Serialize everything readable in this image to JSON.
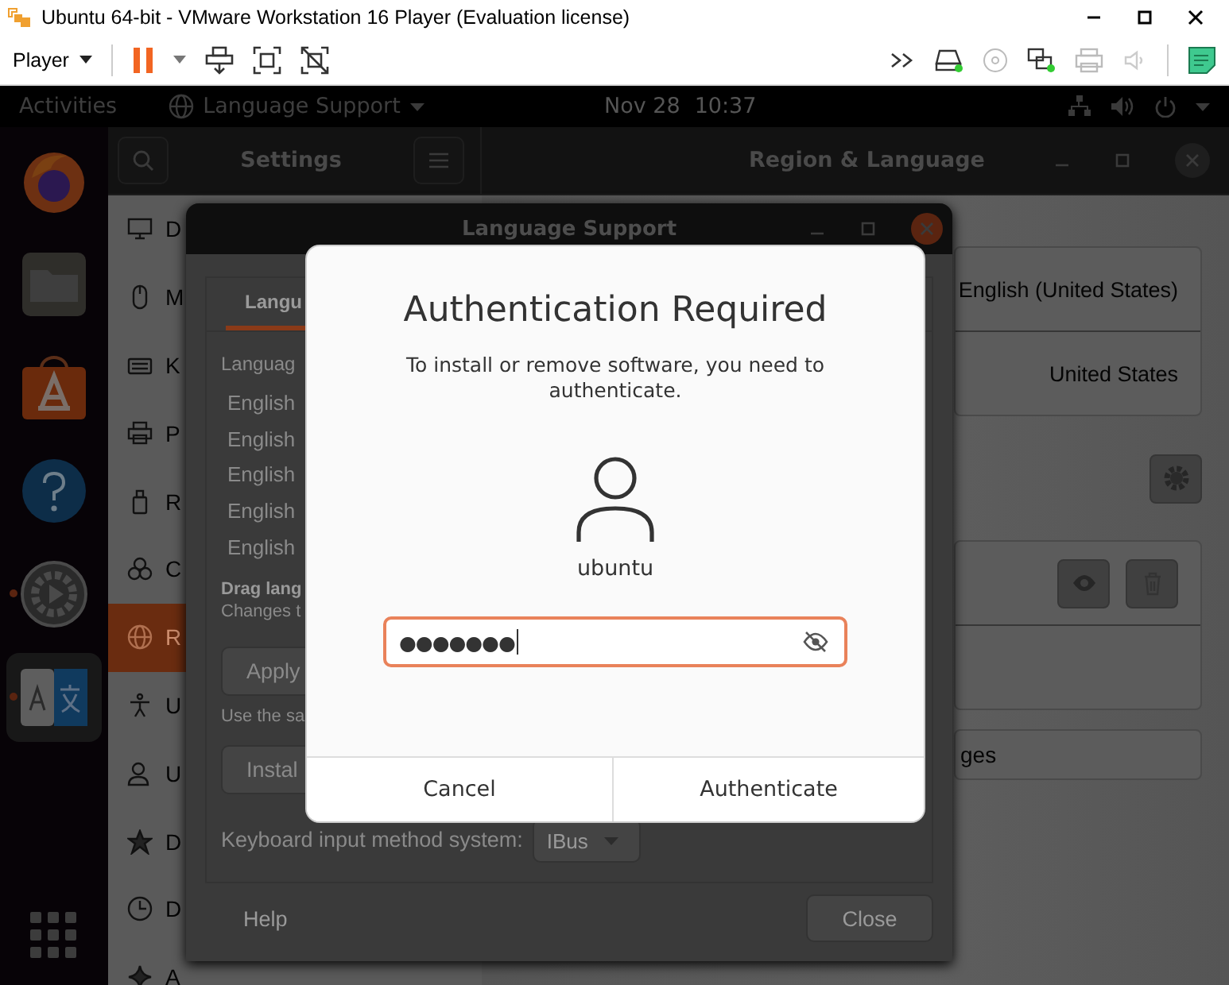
{
  "window": {
    "title": "Ubuntu 64-bit - VMware Workstation 16 Player (Evaluation license)"
  },
  "toolbar": {
    "player_menu": "Player"
  },
  "top_bar": {
    "activities": "Activities",
    "app_menu": "Language Support",
    "date": "Nov 28",
    "time": "10:37"
  },
  "dock": [
    {
      "kind": "firefox",
      "running": false,
      "selected": false
    },
    {
      "kind": "files",
      "running": false,
      "selected": false
    },
    {
      "kind": "software",
      "running": false,
      "selected": false
    },
    {
      "kind": "help",
      "running": false,
      "selected": false
    },
    {
      "kind": "media",
      "running": true,
      "selected": false
    },
    {
      "kind": "language",
      "running": true,
      "selected": true
    }
  ],
  "settings_window": {
    "title": "Settings",
    "panel_title": "Region & Language",
    "sidebar": [
      {
        "kind": "display",
        "label": "D",
        "selected": false
      },
      {
        "kind": "mouse",
        "label": "M",
        "selected": false
      },
      {
        "kind": "keyboard",
        "label": "K",
        "selected": false
      },
      {
        "kind": "printer",
        "label": "P",
        "selected": false
      },
      {
        "kind": "removable",
        "label": "R",
        "selected": false
      },
      {
        "kind": "color",
        "label": "C",
        "selected": false
      },
      {
        "kind": "region",
        "label": "R",
        "selected": true
      },
      {
        "kind": "accessibility",
        "label": "U",
        "selected": false
      },
      {
        "kind": "users",
        "label": "U",
        "selected": false
      },
      {
        "kind": "star",
        "label": "D",
        "selected": false
      },
      {
        "kind": "clock",
        "label": "D",
        "selected": false
      },
      {
        "kind": "sparkle",
        "label": "A",
        "selected": false
      }
    ],
    "rows": [
      {
        "value": "English (United States)"
      },
      {
        "value": "United States"
      }
    ],
    "manage_button": "ges"
  },
  "language_support": {
    "title": "Language Support",
    "tabs": [
      {
        "label": "Langu",
        "selected": true
      }
    ],
    "list_label": "Languag",
    "languages": [
      "English",
      "English",
      "English",
      "English",
      "English"
    ],
    "drag_hint": "Drag lang",
    "changes_hint": "Changes t",
    "apply_button": "Apply",
    "use_hint": "Use the sa",
    "install_button": "Instal",
    "keyboard_label": "Keyboard input method system:",
    "keyboard_value": "IBus",
    "help": "Help",
    "close_button": "Close"
  },
  "auth_dialog": {
    "title": "Authentication Required",
    "message": "To install or remove software, you need to authenticate.",
    "user": "ubuntu",
    "password": "●●●●●●●",
    "cancel_button": "Cancel",
    "confirm_button": "Authenticate"
  }
}
